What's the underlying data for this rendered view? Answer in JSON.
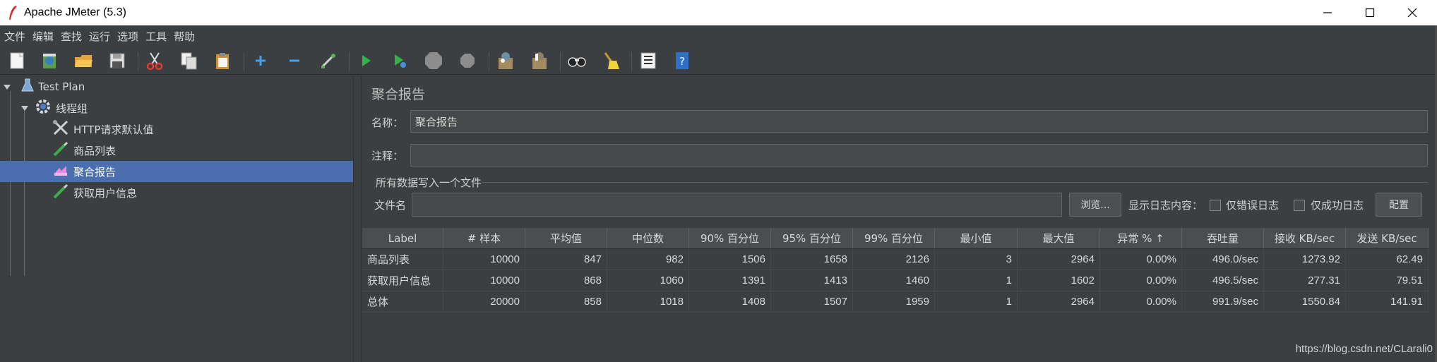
{
  "window": {
    "title": "Apache JMeter (5.3)"
  },
  "menu": [
    "文件",
    "编辑",
    "查找",
    "运行",
    "选项",
    "工具",
    "帮助"
  ],
  "toolbar": [
    "new-icon",
    "templates-icon",
    "open-icon",
    "save-icon",
    "cut-icon",
    "copy-icon",
    "paste-icon",
    "expand-icon",
    "collapse-icon",
    "toggle-icon",
    "start-icon",
    "start-no-timers-icon",
    "stop-icon",
    "shutdown-icon",
    "clear-icon",
    "clear-all-icon",
    "search-icon",
    "reset-search-icon",
    "function-helper-icon",
    "help-icon"
  ],
  "tree": {
    "items": [
      {
        "label": "Test Plan",
        "icon": "flask-icon"
      },
      {
        "label": "线程组",
        "icon": "gear-icon"
      },
      {
        "label": "HTTP请求默认值",
        "icon": "wrench-icon"
      },
      {
        "label": "商品列表",
        "icon": "pipette-icon"
      },
      {
        "label": "聚合报告",
        "icon": "report-icon"
      },
      {
        "label": "获取用户信息",
        "icon": "pipette-icon"
      }
    ],
    "selected": "聚合报告"
  },
  "panel": {
    "title": "聚合报告",
    "name_label": "名称：",
    "name_value": "聚合报告",
    "comment_label": "注释：",
    "comment_value": "",
    "group_title": "所有数据写入一个文件",
    "filename_label": "文件名",
    "filename_value": "",
    "browse_button": "浏览...",
    "log_label": "显示日志内容：",
    "errors_only": "仅错误日志",
    "success_only": "仅成功日志",
    "config_button": "配置"
  },
  "table": {
    "columns": [
      "Label",
      "# 样本",
      "平均值",
      "中位数",
      "90% 百分位",
      "95% 百分位",
      "99% 百分位",
      "最小值",
      "最大值",
      "异常 % ↑",
      "吞吐量",
      "接收 KB/sec",
      "发送 KB/sec"
    ],
    "rows": [
      [
        "商品列表",
        "10000",
        "847",
        "982",
        "1506",
        "1658",
        "2126",
        "3",
        "2964",
        "0.00%",
        "496.0/sec",
        "1273.92",
        "62.49"
      ],
      [
        "获取用户信息",
        "10000",
        "868",
        "1060",
        "1391",
        "1413",
        "1460",
        "1",
        "1602",
        "0.00%",
        "496.5/sec",
        "277.31",
        "79.51"
      ],
      [
        "总体",
        "20000",
        "858",
        "1018",
        "1408",
        "1507",
        "1959",
        "1",
        "2964",
        "0.00%",
        "991.9/sec",
        "1550.84",
        "141.91"
      ]
    ]
  },
  "watermark": "https://blog.csdn.net/CLarali0"
}
